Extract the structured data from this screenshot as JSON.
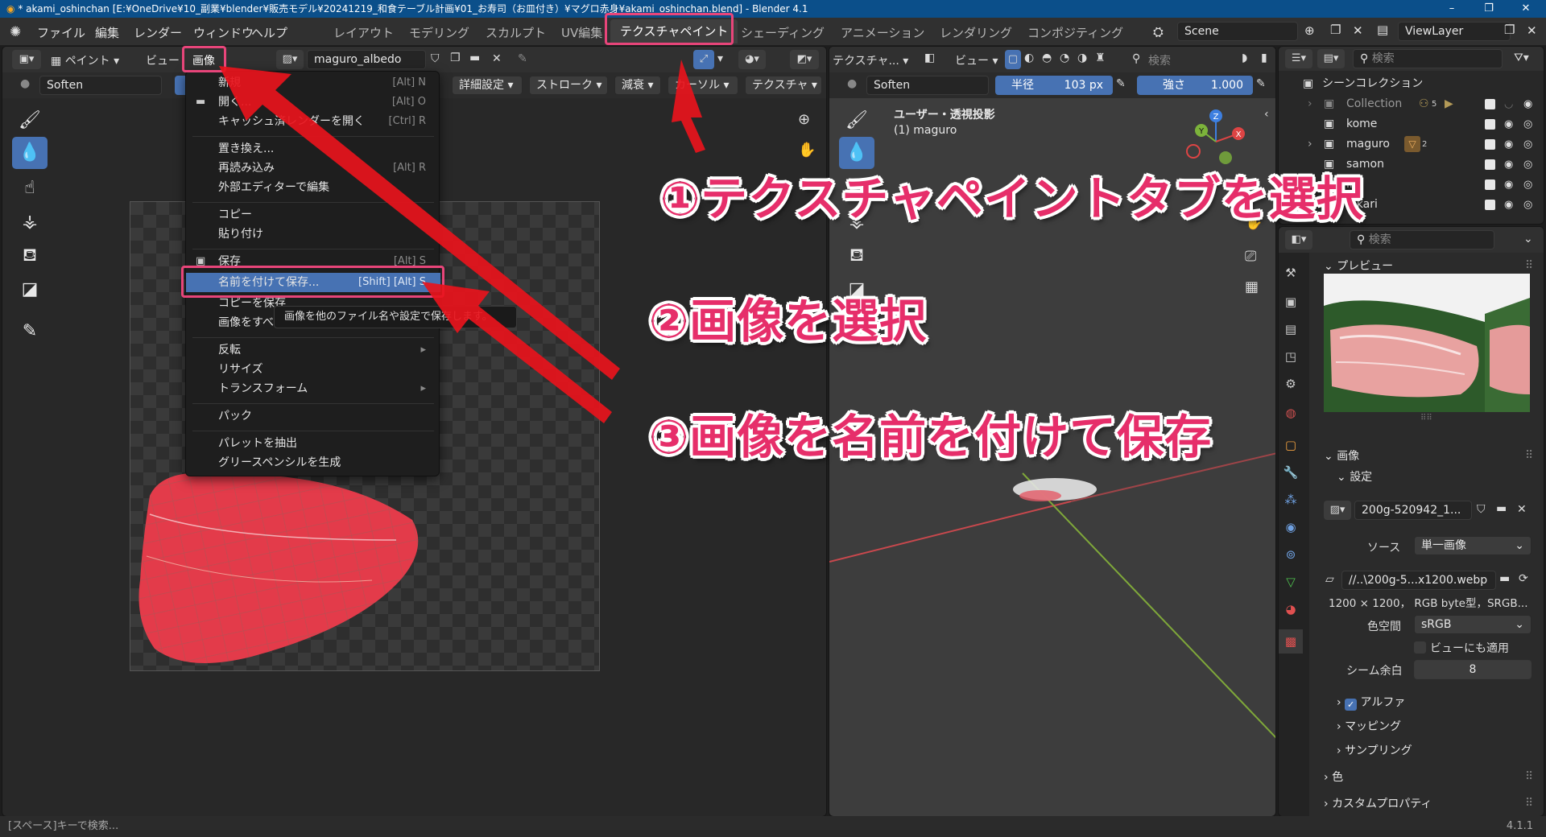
{
  "window": {
    "title": "* akami_oshinchan [E:¥OneDrive¥10_副業¥blender¥販売モデル¥20241219_和食テーブル計画¥01_お寿司（お皿付き）¥マグロ赤身¥akami_oshinchan.blend] - Blender 4.1",
    "min": "–",
    "max": "❐",
    "close": "✕"
  },
  "top_menu": [
    "ファイル",
    "編集",
    "レンダー",
    "ウィンドウ",
    "ヘルプ"
  ],
  "workspaces": [
    "レイアウト",
    "モデリング",
    "スカルプト",
    "UV編集",
    "テクスチャペイント",
    "シェーディング",
    "アニメーション",
    "レンダリング",
    "コンポジティング"
  ],
  "active_workspace": "テクスチャペイント",
  "scene": "Scene",
  "view_layer": "ViewLayer",
  "image_editor": {
    "mode": "ペイント",
    "view_menu": "ビュー",
    "image_menu": "画像",
    "image_name": "maguro_albedo",
    "brush": "Soften",
    "tool_tabs": [
      "詳細設定",
      "ストローク",
      "減衰",
      "カーソル",
      "テクスチャ"
    ]
  },
  "image_menu_items": [
    {
      "label": "新規",
      "shortcut": "[Alt] N"
    },
    {
      "label": "開く...",
      "shortcut": "[Alt] O"
    },
    {
      "label": "キャッシュ済レンダーを開く",
      "shortcut": "[Ctrl] R"
    },
    {
      "label": "置き換え...",
      "shortcut": ""
    },
    {
      "label": "再読み込み",
      "shortcut": "[Alt] R"
    },
    {
      "label": "外部エディターで編集",
      "shortcut": ""
    },
    {
      "label": "コピー",
      "shortcut": ""
    },
    {
      "label": "貼り付け",
      "shortcut": ""
    },
    {
      "label": "保存",
      "shortcut": "[Alt] S"
    },
    {
      "label": "名前を付けて保存...",
      "shortcut": "[Shift] [Alt] S"
    },
    {
      "label": "コピーを保存",
      "shortcut": ""
    },
    {
      "label": "画像をすべて保存",
      "shortcut": ""
    },
    {
      "label": "反転",
      "shortcut": ""
    },
    {
      "label": "リサイズ",
      "shortcut": ""
    },
    {
      "label": "トランスフォーム",
      "shortcut": ""
    },
    {
      "label": "パック",
      "shortcut": ""
    },
    {
      "label": "パレットを抽出",
      "shortcut": ""
    },
    {
      "label": "グリースペンシルを生成",
      "shortcut": ""
    }
  ],
  "tooltip": "画像を他のファイル名や設定で保存します。",
  "viewport": {
    "mode": "テクスチャ...",
    "view_menu": "ビュー",
    "brush": "Soften",
    "radius_label": "半径",
    "radius_value": "103 px",
    "strength_label": "強さ",
    "strength_value": "1.000",
    "search_placeholder": "検索",
    "view_name": "ユーザー・透視投影",
    "object_name": "(1) maguro",
    "axis_x": "X",
    "axis_y": "Y",
    "axis_z": "Z"
  },
  "annotations": {
    "step1": "①テクスチャペイントタブを選択",
    "step2": "②画像を選択",
    "step3": "③画像を名前を付けて保存"
  },
  "outliner": {
    "search_placeholder": "検索",
    "root": "シーンコレクション",
    "items": [
      "Collection",
      "kome",
      "maguro",
      "samon",
      "ika",
      "hikari"
    ],
    "collection_badge": "5",
    "maguro_badge": "2"
  },
  "properties": {
    "search_placeholder": "検索",
    "preview_label": "プレビュー",
    "image_section": "画像",
    "settings_section": "設定",
    "image_name": "200g-520942_1...",
    "source_label": "ソース",
    "source_value": "単一画像",
    "filepath": "//..\\200g-5...x1200.webp",
    "info": "1200 × 1200，  RGB byte型，SRGB...",
    "colorspace_label": "色空間",
    "colorspace_value": "sRGB",
    "apply_view": "ビューにも適用",
    "seam_margin_label": "シーム余白",
    "seam_margin_value": "8",
    "alpha": "アルファ",
    "mapping": "マッピング",
    "sampling": "サンプリング",
    "color": "色",
    "custom_props": "カスタムプロパティ"
  },
  "status": {
    "hint": "[スペース]キーで検索...",
    "version": "4.1.1"
  },
  "colors": {
    "accent": "#4772b3",
    "annotation": "#e62e6a",
    "highlight_box": "#e8457a",
    "arrow": "#e8141c"
  }
}
